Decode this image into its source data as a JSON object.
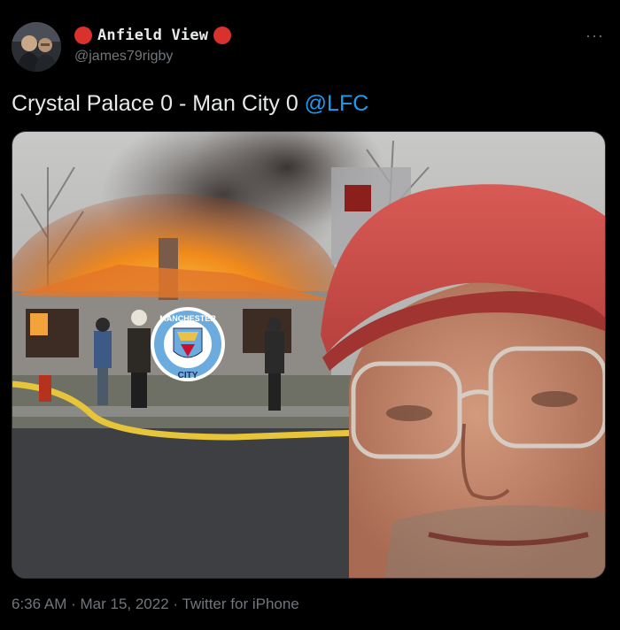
{
  "tweet": {
    "display_name": "Anfield View",
    "handle": "@james79rigby",
    "text": "Crystal Palace 0 - Man City 0 ",
    "mention": "@LFC",
    "timestamp": "6:36 AM",
    "date": "Mar 15, 2022",
    "source": "Twitter for iPhone",
    "separator": " · ",
    "more_icon": "more-horizontal-icon",
    "name_decoration_color": "#d9312b",
    "mention_color": "#1d9bf0"
  },
  "media": {
    "badge_top_text": "MANCHESTER",
    "badge_bottom_text": "CITY"
  }
}
